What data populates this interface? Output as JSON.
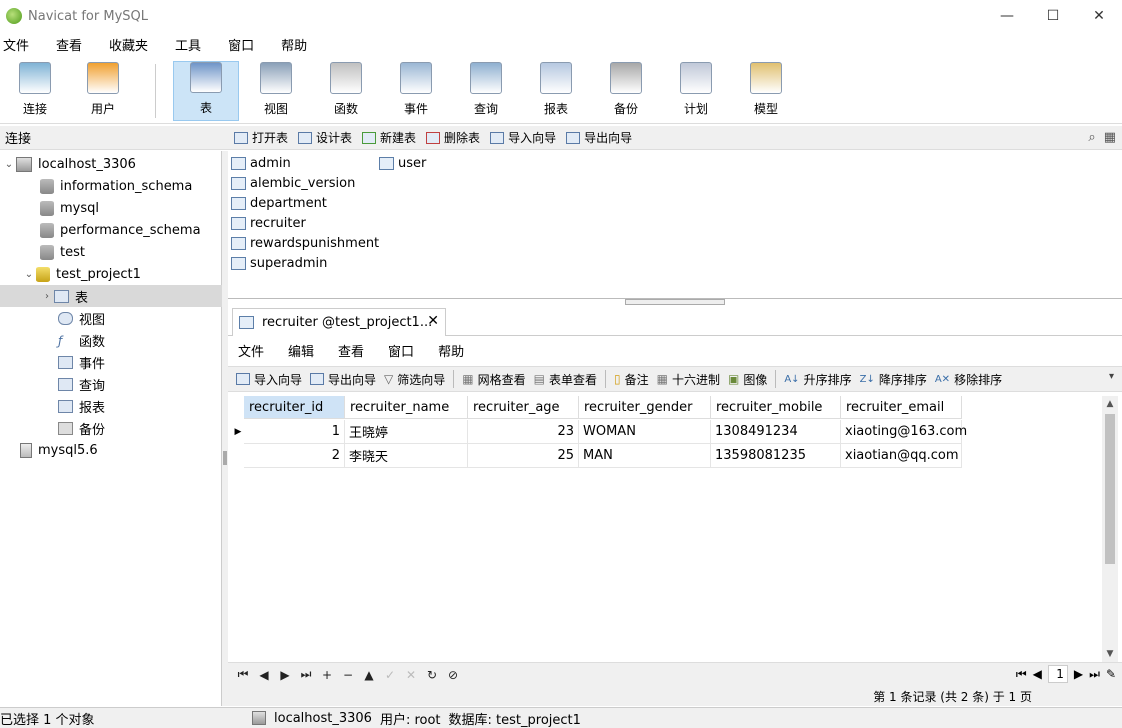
{
  "window": {
    "title": "Navicat for MySQL",
    "controls": [
      "—",
      "☐",
      "✕"
    ]
  },
  "menubar": [
    "文件",
    "查看",
    "收藏夹",
    "工具",
    "窗口",
    "帮助"
  ],
  "toolbar": {
    "items": [
      {
        "label": "连接",
        "icon": "connection-icon",
        "color": "#7fb3d5"
      },
      {
        "label": "用户",
        "icon": "user-icon",
        "color": "#f0a030"
      },
      {
        "label": "表",
        "icon": "table-icon",
        "color": "#6f95c8"
      },
      {
        "label": "视图",
        "icon": "view-icon",
        "color": "#8aa0b8"
      },
      {
        "label": "函数",
        "icon": "function-icon",
        "color": "#c0c0c0"
      },
      {
        "label": "事件",
        "icon": "event-icon",
        "color": "#9bb7d4"
      },
      {
        "label": "查询",
        "icon": "query-icon",
        "color": "#8fb0d0"
      },
      {
        "label": "报表",
        "icon": "report-icon",
        "color": "#b6c8e0"
      },
      {
        "label": "备份",
        "icon": "backup-icon",
        "color": "#a8a8a8"
      },
      {
        "label": "计划",
        "icon": "schedule-icon",
        "color": "#c0c8d8"
      },
      {
        "label": "模型",
        "icon": "model-icon",
        "color": "#e0c070"
      }
    ]
  },
  "sidebar": {
    "header": "连接",
    "tree": {
      "server": "localhost_3306",
      "databases": [
        "information_schema",
        "mysql",
        "performance_schema",
        "test"
      ],
      "open_db": "test_project1",
      "open_db_children": [
        "表",
        "视图",
        "函数",
        "事件",
        "查询",
        "报表",
        "备份"
      ],
      "other_server": "mysql5.6"
    }
  },
  "object_toolbar": [
    "打开表",
    "设计表",
    "新建表",
    "删除表",
    "导入向导",
    "导出向导"
  ],
  "object_list": {
    "col1": [
      "admin",
      "alembic_version",
      "department",
      "recruiter",
      "rewardspunishment",
      "superadmin"
    ],
    "col2": [
      "user"
    ]
  },
  "tab": {
    "label": "recruiter @test_project1...",
    "close": "✕"
  },
  "inner_menu": [
    "文件",
    "编辑",
    "查看",
    "窗口",
    "帮助"
  ],
  "grid_toolbar": [
    "导入向导",
    "导出向导",
    "筛选向导",
    "网格查看",
    "表单查看",
    "备注",
    "十六进制",
    "图像",
    "升序排序",
    "降序排序",
    "移除排序"
  ],
  "table": {
    "columns": [
      "recruiter_id",
      "recruiter_name",
      "recruiter_age",
      "recruiter_gender",
      "recruiter_mobile",
      "recruiter_email"
    ],
    "rows": [
      [
        "1",
        "王晓婷",
        "23",
        "WOMAN",
        "1308491234",
        "xiaoting@163.com"
      ],
      [
        "2",
        "李晓天",
        "25",
        "MAN",
        "13598081235",
        "xiaotian@qq.com"
      ]
    ]
  },
  "navbar": {
    "page": "1",
    "record_info": "第 1 条记录 (共 2 条) 于 1 页"
  },
  "statusbar": {
    "left": "已选择 1 个对象",
    "server": "localhost_3306",
    "user": "用户: root",
    "db": "数据库: test_project1"
  }
}
